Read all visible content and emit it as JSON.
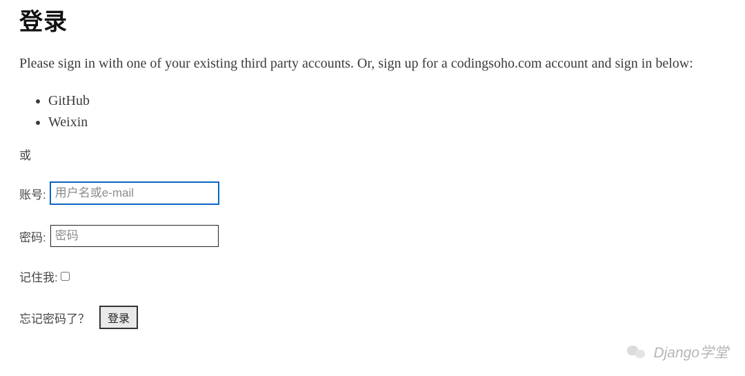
{
  "page": {
    "title": "登录",
    "intro": "Please sign in with one of your existing third party accounts. Or, sign up for a codingsoho.com account and sign in below:",
    "providers": [
      "GitHub",
      "Weixin"
    ],
    "or_label": "或"
  },
  "form": {
    "username_label": "账号:",
    "username_placeholder": "用户名或e-mail",
    "username_value": "",
    "password_label": "密码:",
    "password_placeholder": "密码",
    "password_value": "",
    "remember_label": "记住我:",
    "remember_checked": false,
    "forgot_label": "忘记密码了？",
    "submit_label": "登录"
  },
  "watermark": {
    "text": "Django学堂",
    "icon": "wechat-icon"
  }
}
